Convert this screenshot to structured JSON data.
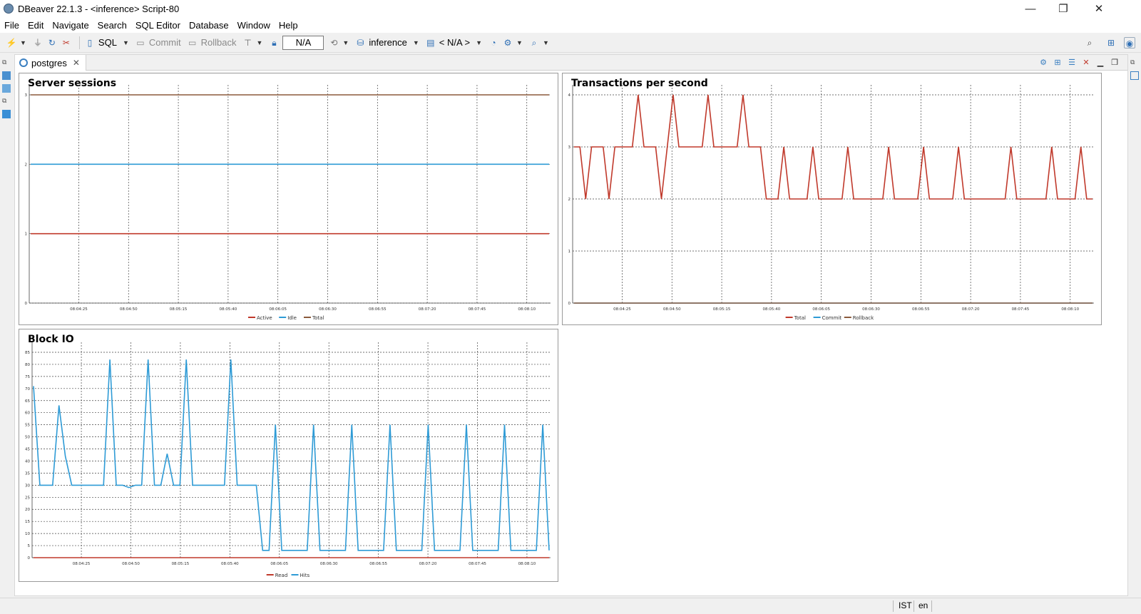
{
  "window": {
    "title": "DBeaver 22.1.3 - <inference> Script-80",
    "minimize": "—",
    "maximize": "❐",
    "close": "✕"
  },
  "menu": [
    "File",
    "Edit",
    "Navigate",
    "Search",
    "SQL Editor",
    "Database",
    "Window",
    "Help"
  ],
  "toolbar": {
    "sql_label": "SQL",
    "commit_label": "Commit",
    "rollback_label": "Rollback",
    "tx_mode_value": "N/A",
    "datasource_label": "inference",
    "schema_label": "< N/A >"
  },
  "editor_tab": {
    "label": "postgres",
    "close": "✕"
  },
  "status": {
    "timezone": "IST",
    "locale": "en"
  },
  "colors": {
    "red": "#c0392b",
    "blue": "#2e9bd6",
    "brown": "#8b5a3c"
  },
  "charts": [
    {
      "id": "sessions",
      "title": "Server sessions",
      "chart_data": {
        "type": "line",
        "x": [
          "08:04:25",
          "08:04:50",
          "08:05:15",
          "08:05:40",
          "08:06:05",
          "08:06:30",
          "08:06:55",
          "08:07:20",
          "08:07:45",
          "08:08:10"
        ],
        "ylim": [
          0,
          3
        ],
        "yticks": [
          0,
          1,
          2,
          3
        ],
        "series": [
          {
            "name": "Active",
            "color": "#c0392b",
            "values": [
              1,
              1,
              1,
              1,
              1,
              1,
              1,
              1,
              1,
              1,
              1,
              1
            ]
          },
          {
            "name": "Idle",
            "color": "#2e9bd6",
            "values": [
              2,
              2,
              2,
              2,
              2,
              2,
              2,
              2,
              2,
              2,
              2,
              2
            ]
          },
          {
            "name": "Total",
            "color": "#8b5a3c",
            "values": [
              3,
              3,
              3,
              3,
              3,
              3,
              3,
              3,
              3,
              3,
              3,
              3
            ]
          }
        ]
      }
    },
    {
      "id": "tps",
      "title": "Transactions per second",
      "chart_data": {
        "type": "line",
        "x": [
          "08:04:25",
          "08:04:50",
          "08:05:15",
          "08:05:40",
          "08:06:05",
          "08:06:30",
          "08:06:55",
          "08:07:20",
          "08:07:45",
          "08:08:10"
        ],
        "ylim": [
          0,
          4
        ],
        "yticks": [
          0,
          1,
          2,
          3,
          4
        ],
        "series": [
          {
            "name": "Total",
            "color": "#c0392b",
            "values": [
              3,
              3,
              2,
              3,
              3,
              3,
              2,
              3,
              3,
              3,
              3,
              4,
              3,
              3,
              3,
              2,
              3,
              4,
              3,
              3,
              3,
              3,
              3,
              4,
              3,
              3,
              3,
              3,
              3,
              4,
              3,
              3,
              3,
              2,
              2,
              2,
              3,
              2,
              2,
              2,
              2,
              3,
              2,
              2,
              2,
              2,
              2,
              3,
              2,
              2,
              2,
              2,
              2,
              2,
              3,
              2,
              2,
              2,
              2,
              2,
              3,
              2,
              2,
              2,
              2,
              2,
              3,
              2,
              2,
              2,
              2,
              2,
              2,
              2,
              2,
              3,
              2,
              2,
              2,
              2,
              2,
              2,
              3,
              2,
              2,
              2,
              2,
              3,
              2,
              2
            ]
          },
          {
            "name": "Commit",
            "color": "#2e9bd6",
            "values": [
              0,
              0,
              0,
              0,
              0,
              0,
              0,
              0,
              0,
              0,
              0,
              0
            ]
          },
          {
            "name": "Rollback",
            "color": "#8b5a3c",
            "values": [
              0,
              0,
              0,
              0,
              0,
              0,
              0,
              0,
              0,
              0,
              0,
              0
            ]
          }
        ]
      }
    },
    {
      "id": "blockio",
      "title": "Block IO",
      "chart_data": {
        "type": "line",
        "x": [
          "08:04:25",
          "08:04:50",
          "08:05:15",
          "08:05:40",
          "08:06:05",
          "08:06:30",
          "08:06:55",
          "08:07:20",
          "08:07:45",
          "08:08:10"
        ],
        "ylim": [
          0,
          85
        ],
        "yticks": [
          0,
          5,
          10,
          15,
          20,
          25,
          30,
          35,
          40,
          45,
          50,
          55,
          60,
          65,
          70,
          75,
          80,
          85
        ],
        "series": [
          {
            "name": "Read",
            "color": "#c0392b",
            "values": [
              0,
              0,
              0,
              0,
              0,
              0,
              0,
              0,
              0,
              0,
              0,
              0
            ]
          },
          {
            "name": "Hits",
            "color": "#2e9bd6",
            "values": [
              71,
              30,
              30,
              30,
              63,
              42,
              30,
              30,
              30,
              30,
              30,
              30,
              82,
              30,
              30,
              29,
              30,
              30,
              82,
              30,
              30,
              43,
              30,
              30,
              82,
              30,
              30,
              30,
              30,
              30,
              30,
              82,
              30,
              30,
              30,
              30,
              3,
              3,
              55,
              3,
              3,
              3,
              3,
              3,
              55,
              3,
              3,
              3,
              3,
              3,
              55,
              3,
              3,
              3,
              3,
              3,
              55,
              3,
              3,
              3,
              3,
              3,
              55,
              3,
              3,
              3,
              3,
              3,
              55,
              3,
              3,
              3,
              3,
              3,
              55,
              3,
              3,
              3,
              3,
              3,
              55,
              3
            ]
          }
        ]
      }
    }
  ]
}
